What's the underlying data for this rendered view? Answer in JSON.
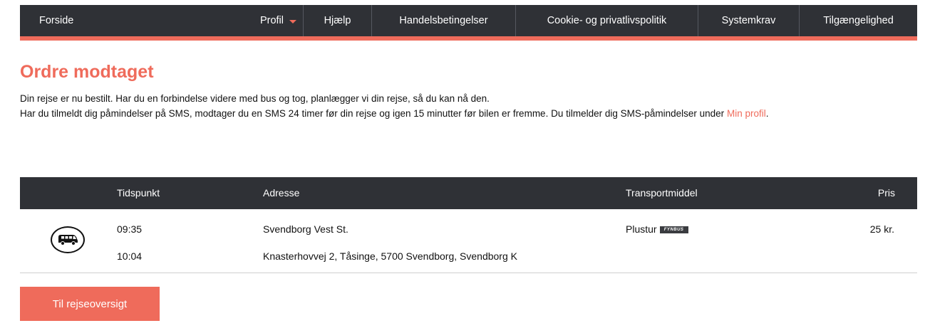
{
  "nav": {
    "home": "Forside",
    "items": [
      {
        "label": "Profil"
      },
      {
        "label": "Hjælp"
      },
      {
        "label": "Handelsbetingelser"
      },
      {
        "label": "Cookie- og privatlivspolitik"
      },
      {
        "label": "Systemkrav"
      },
      {
        "label": "Tilgængelighed"
      }
    ]
  },
  "colors": {
    "accent": "#ef6b5b",
    "dark": "#2f3136"
  },
  "page": {
    "title": "Ordre modtaget",
    "line1": "Din rejse er nu bestilt. Har du en forbindelse videre med bus og tog, planlægger vi din rejse, så du kan nå den.",
    "line2": "Har du tilmeldt dig påmindelser på SMS, modtager du en SMS 24 timer før din rejse og igen 15 minutter før bilen er fremme. Du tilmelder dig SMS-påmindelser under",
    "link": "Min profil",
    "link_suffix": "."
  },
  "table": {
    "headers": {
      "time": "Tidspunkt",
      "address": "Adresse",
      "transport": "Transportmiddel",
      "price": "Pris"
    },
    "row": {
      "icon": "bus-icon",
      "departure_time": "09:35",
      "arrival_time": "10:04",
      "from_address": "Svendborg Vest St.",
      "to_address": "Knasterhovvej 2, Tåsinge, 5700 Svendborg, Svendborg K",
      "transport": "Plustur",
      "brand_badge": "FYNBUS",
      "price": "25 kr."
    }
  },
  "button": {
    "label": "Til rejseoversigt"
  }
}
